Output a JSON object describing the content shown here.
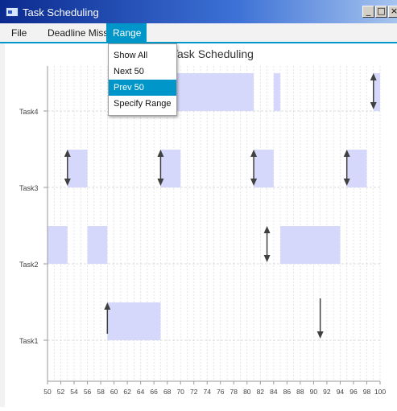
{
  "window": {
    "title": "Task Scheduling",
    "controls": {
      "minimize": "_",
      "maximize": "□",
      "close": "×"
    }
  },
  "menubar": {
    "items": [
      {
        "label": "File"
      },
      {
        "label": "Deadline Miss"
      },
      {
        "label": "Range",
        "active": true
      }
    ]
  },
  "range_menu": {
    "items": [
      {
        "label": "Show All"
      },
      {
        "label": "Next 50"
      },
      {
        "label": "Prev 50",
        "highlighted": true
      },
      {
        "label": "Specify Range"
      }
    ]
  },
  "colors": {
    "accent": "#0096c9",
    "bar": "#d6d8fb",
    "titlebar": "#0b2a8f"
  },
  "chart_data": {
    "type": "gantt",
    "title": "Task Scheduling",
    "xlim": [
      50,
      100
    ],
    "x_ticks": [
      50,
      52,
      54,
      56,
      58,
      60,
      62,
      64,
      66,
      68,
      70,
      72,
      74,
      76,
      78,
      80,
      82,
      84,
      86,
      88,
      90,
      92,
      94,
      96,
      98,
      100
    ],
    "tasks": [
      "Task4",
      "Task3",
      "Task2",
      "Task1"
    ],
    "executions": [
      {
        "task": "Task4",
        "start": 68,
        "end": 81
      },
      {
        "task": "Task4",
        "start": 84,
        "end": 85
      },
      {
        "task": "Task4",
        "start": 99,
        "end": 100
      },
      {
        "task": "Task3",
        "start": 53,
        "end": 56
      },
      {
        "task": "Task3",
        "start": 67,
        "end": 70
      },
      {
        "task": "Task3",
        "start": 81,
        "end": 84
      },
      {
        "task": "Task3",
        "start": 95,
        "end": 98
      },
      {
        "task": "Task2",
        "start": 50,
        "end": 53
      },
      {
        "task": "Task2",
        "start": 56,
        "end": 59
      },
      {
        "task": "Task2",
        "start": 85,
        "end": 94
      },
      {
        "task": "Task1",
        "start": 59,
        "end": 67
      }
    ],
    "markers": [
      {
        "task": "Task4",
        "x": 99,
        "kind": "both"
      },
      {
        "task": "Task3",
        "x": 53,
        "kind": "both"
      },
      {
        "task": "Task3",
        "x": 67,
        "kind": "both"
      },
      {
        "task": "Task3",
        "x": 81,
        "kind": "both"
      },
      {
        "task": "Task3",
        "x": 95,
        "kind": "both"
      },
      {
        "task": "Task2",
        "x": 83,
        "kind": "both"
      },
      {
        "task": "Task1",
        "x": 59,
        "kind": "release"
      },
      {
        "task": "Task1",
        "x": 91,
        "kind": "deadline"
      }
    ]
  }
}
